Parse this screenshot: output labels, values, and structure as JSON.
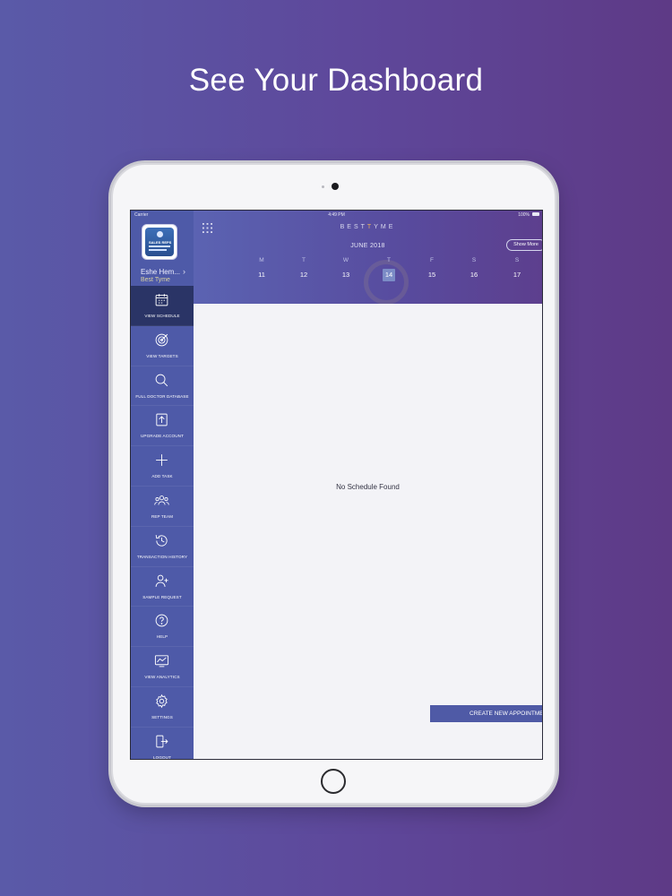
{
  "headline": "See Your Dashboard",
  "statusbar": {
    "carrier": "Carrier",
    "time": "4:49 PM",
    "battery": "100%"
  },
  "profile": {
    "name": "Eshe Hem...",
    "company": "Best Tyme",
    "logo_text": "SALES REPS"
  },
  "brand": {
    "prefix": "BEST",
    "accent": "T",
    "suffix": "YME"
  },
  "calendar": {
    "month": "JUNE 2018",
    "show_more_label": "Show More",
    "days": [
      {
        "name": "M",
        "num": "11",
        "selected": false
      },
      {
        "name": "T",
        "num": "12",
        "selected": false
      },
      {
        "name": "W",
        "num": "13",
        "selected": false
      },
      {
        "name": "T",
        "num": "14",
        "selected": true
      },
      {
        "name": "F",
        "num": "15",
        "selected": false
      },
      {
        "name": "S",
        "num": "16",
        "selected": false
      },
      {
        "name": "S",
        "num": "17",
        "selected": false
      }
    ]
  },
  "sidebar": {
    "items": [
      {
        "label": "VIEW SCHEDULE",
        "icon": "calendar-icon",
        "active": true
      },
      {
        "label": "VIEW TARGETS",
        "icon": "target-icon",
        "active": false
      },
      {
        "label": "FULL DOCTOR DATABASE",
        "icon": "search-icon",
        "active": false
      },
      {
        "label": "UPGRADE ACCOUNT",
        "icon": "upgrade-icon",
        "active": false
      },
      {
        "label": "ADD TASK",
        "icon": "plus-icon",
        "active": false
      },
      {
        "label": "REP TEAM",
        "icon": "team-icon",
        "active": false
      },
      {
        "label": "TRANSACTION HISTORY",
        "icon": "history-icon",
        "active": false
      },
      {
        "label": "SAMPLE REQUEST",
        "icon": "user-request-icon",
        "active": false
      },
      {
        "label": "HELP",
        "icon": "help-icon",
        "active": false
      },
      {
        "label": "VIEW ANALYTICS",
        "icon": "analytics-icon",
        "active": false
      },
      {
        "label": "SETTINGS",
        "icon": "gear-icon",
        "active": false
      },
      {
        "label": "LOGOUT",
        "icon": "logout-icon",
        "active": false
      }
    ]
  },
  "main": {
    "empty_message": "No Schedule Found",
    "create_button_label": "CREATE NEW APPOINTMENT"
  },
  "colors": {
    "sidebar": "#4e5aa8",
    "sidebar_active": "#2a3466",
    "accent": "#e8b15a",
    "button": "#4f5aa6"
  }
}
